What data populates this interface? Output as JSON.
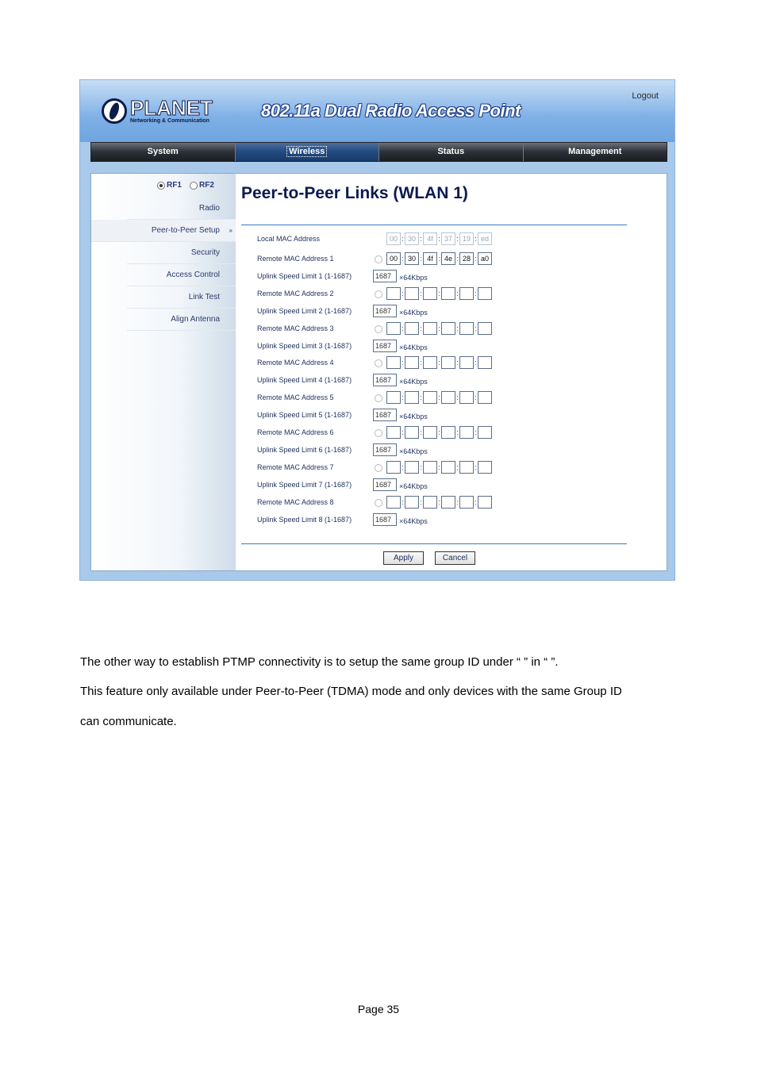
{
  "header": {
    "logo_word": "PLANET",
    "logo_sub": "Networking & Communication",
    "product_title": "802.11a Dual Radio Access Point",
    "logout": "Logout"
  },
  "nav": {
    "tabs": [
      {
        "label": "System",
        "active": false
      },
      {
        "label": "Wireless",
        "active": true
      },
      {
        "label": "Status",
        "active": false
      },
      {
        "label": "Management",
        "active": false
      }
    ]
  },
  "sidebar": {
    "rf1": "RF1",
    "rf2": "RF2",
    "rf_selected": "RF1",
    "items": [
      {
        "label": "Radio",
        "active": false
      },
      {
        "label": "Peer-to-Peer Setup",
        "active": true,
        "arrow": "»"
      },
      {
        "label": "Security",
        "active": false
      },
      {
        "label": "Access Control",
        "active": false
      },
      {
        "label": "Link Test",
        "active": false
      },
      {
        "label": "Align Antenna",
        "active": false
      }
    ]
  },
  "main": {
    "title": "Peer-to-Peer Links (WLAN 1)",
    "local_mac": {
      "label": "Local MAC Address",
      "octets": [
        "00",
        "30",
        "4f",
        "37",
        "19",
        "ed"
      ]
    },
    "links": [
      {
        "mac_label": "Remote MAC Address 1",
        "octets": [
          "00",
          "30",
          "4f",
          "4e",
          "28",
          "a0"
        ],
        "speed_label": "Uplink Speed Limit 1 (1-1687)",
        "speed": "1687"
      },
      {
        "mac_label": "Remote MAC Address 2",
        "octets": [
          "",
          "",
          "",
          "",
          "",
          ""
        ],
        "speed_label": "Uplink Speed Limit 2 (1-1687)",
        "speed": "1687"
      },
      {
        "mac_label": "Remote MAC Address 3",
        "octets": [
          "",
          "",
          "",
          "",
          "",
          ""
        ],
        "speed_label": "Uplink Speed Limit 3 (1-1687)",
        "speed": "1687"
      },
      {
        "mac_label": "Remote MAC Address 4",
        "octets": [
          "",
          "",
          "",
          "",
          "",
          ""
        ],
        "speed_label": "Uplink Speed Limit 4 (1-1687)",
        "speed": "1687"
      },
      {
        "mac_label": "Remote MAC Address 5",
        "octets": [
          "",
          "",
          "",
          "",
          "",
          ""
        ],
        "speed_label": "Uplink Speed Limit 5 (1-1687)",
        "speed": "1687"
      },
      {
        "mac_label": "Remote MAC Address 6",
        "octets": [
          "",
          "",
          "",
          "",
          "",
          ""
        ],
        "speed_label": "Uplink Speed Limit 6 (1-1687)",
        "speed": "1687"
      },
      {
        "mac_label": "Remote MAC Address 7",
        "octets": [
          "",
          "",
          "",
          "",
          "",
          ""
        ],
        "speed_label": "Uplink Speed Limit 7 (1-1687)",
        "speed": "1687"
      },
      {
        "mac_label": "Remote MAC Address 8",
        "octets": [
          "",
          "",
          "",
          "",
          "",
          ""
        ],
        "speed_label": "Uplink Speed Limit 8 (1-1687)",
        "speed": "1687"
      }
    ],
    "speed_unit": "×64Kbps",
    "apply": "Apply",
    "cancel": "Cancel"
  },
  "document": {
    "line1": "The other way to establish PTMP connectivity is to setup the same group ID under “          ” in “               ”.",
    "line2": "This feature only available under Peer-to-Peer (TDMA) mode and only devices with the same Group ID",
    "line3": "can communicate.",
    "page_number": "Page 35"
  }
}
